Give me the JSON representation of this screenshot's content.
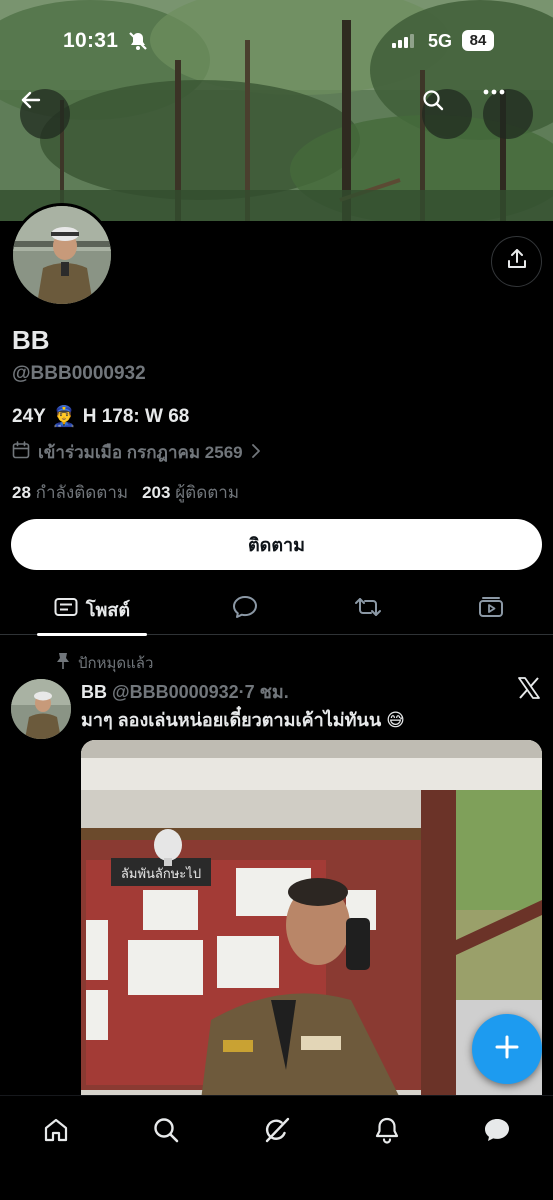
{
  "status_bar": {
    "time": "10:31",
    "network": "5G",
    "battery": "84"
  },
  "profile": {
    "display_name": "BB",
    "handle": "@BBB0000932",
    "bio_prefix": "24Y",
    "bio_emoji": "👮‍♂️",
    "bio_suffix": "H 178: W 68",
    "joined": "เข้าร่วมเมือ กรกฎาคม 2569",
    "following_count": "28",
    "following_label": "กำลังติดตาม",
    "followers_count": "203",
    "followers_label": "ผู้ติดตาม",
    "follow_button": "ติดตาม"
  },
  "tabs": [
    {
      "label": "โพสต์",
      "icon": "posts-icon",
      "active": true
    },
    {
      "label": "",
      "icon": "replies-icon",
      "active": false
    },
    {
      "label": "",
      "icon": "repost-icon",
      "active": false
    },
    {
      "label": "",
      "icon": "media-icon",
      "active": false
    }
  ],
  "post": {
    "pinned_label": "ปักหมุดแล้ว",
    "author_name": "BB",
    "author_handle": "@BBB0000932",
    "separator": "·",
    "time_ago": "7 ชม.",
    "text": "มาๆ ลองเล่นหน่อยเดี๋ยวตามเค้าไม่ทันน",
    "text_emoji": "😅",
    "media_sign_text": "ลัมพันลักษะไป"
  },
  "bottom_nav": [
    "home-icon",
    "search-icon",
    "grok-icon",
    "notifications-icon",
    "messages-icon"
  ],
  "colors": {
    "accent": "#1d9bf0",
    "background": "#000000",
    "text_primary": "#e7e9ea",
    "text_secondary": "#71767b"
  }
}
